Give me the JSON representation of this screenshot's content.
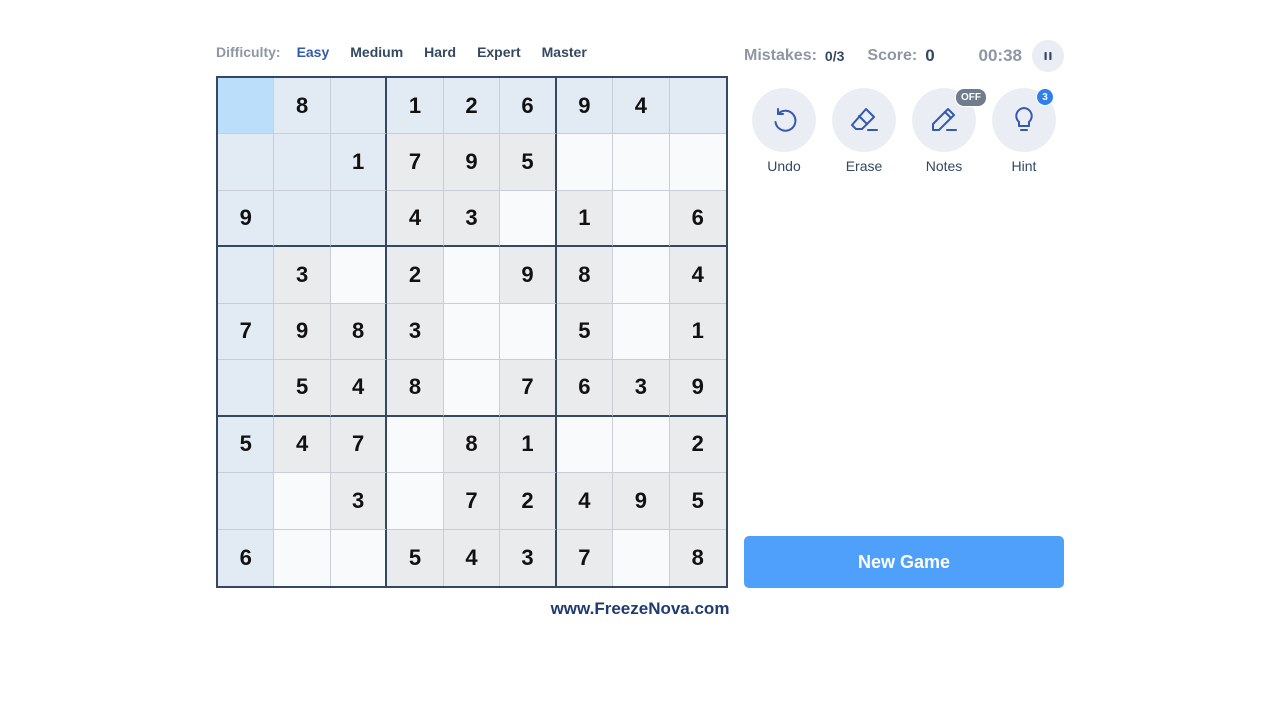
{
  "difficulty": {
    "label": "Difficulty:",
    "options": [
      "Easy",
      "Medium",
      "Hard",
      "Expert",
      "Master"
    ],
    "selected": "Easy"
  },
  "status": {
    "mistakes_label": "Mistakes:",
    "mistakes_value": "0/3",
    "score_label": "Score:",
    "score_value": "0",
    "timer": "00:38"
  },
  "board": {
    "rows": [
      [
        "",
        "8",
        "",
        "1",
        "2",
        "6",
        "9",
        "4",
        ""
      ],
      [
        "",
        "",
        "1",
        "7",
        "9",
        "5",
        "",
        "",
        ""
      ],
      [
        "9",
        "",
        "",
        "4",
        "3",
        "",
        "1",
        "",
        "6"
      ],
      [
        "",
        "3",
        "",
        "2",
        "",
        "9",
        "8",
        "",
        "4"
      ],
      [
        "7",
        "9",
        "8",
        "3",
        "",
        "",
        "5",
        "",
        "1"
      ],
      [
        "",
        "5",
        "4",
        "8",
        "",
        "7",
        "6",
        "3",
        "9"
      ],
      [
        "5",
        "4",
        "7",
        "",
        "8",
        "1",
        "",
        "",
        "2"
      ],
      [
        "",
        "",
        "3",
        "",
        "7",
        "2",
        "4",
        "9",
        "5"
      ],
      [
        "6",
        "",
        "",
        "5",
        "4",
        "3",
        "7",
        "",
        "8"
      ]
    ],
    "selected_cell": {
      "row": 1,
      "col": 1
    }
  },
  "tools": {
    "undo_label": "Undo",
    "erase_label": "Erase",
    "notes_label": "Notes",
    "notes_state": "OFF",
    "hint_label": "Hint",
    "hint_count": "3"
  },
  "new_game_label": "New Game",
  "watermark": "www.FreezeNova.com",
  "colors": {
    "accent": "#4ea0fb",
    "selected_cell": "#bbdefb",
    "highlight": "#e2ebf3",
    "given_cell": "#eaebed",
    "text_dark": "#344861",
    "text_muted": "#8f96a3"
  }
}
